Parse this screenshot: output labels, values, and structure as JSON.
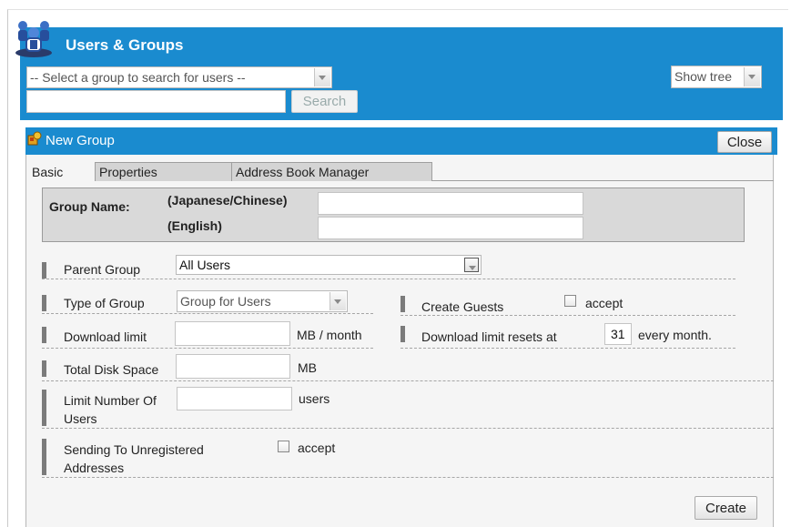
{
  "header": {
    "title": "Users & Groups",
    "group_select": "-- Select a group to search for users --",
    "search_value": "",
    "search_button": "Search",
    "show_tree": "Show tree"
  },
  "panel": {
    "title": "New Group",
    "close_button": "Close",
    "tabs": [
      "Basic",
      "Properties",
      "Address Book Manager"
    ],
    "active_tab": "Basic"
  },
  "form": {
    "group_name_label": "Group Name:",
    "japanese_chinese_label": "(Japanese/Chinese)",
    "english_label": "(English)",
    "parent_group_label": "Parent Group",
    "parent_group_value": "All Users",
    "type_of_group_label": "Type of Group",
    "type_of_group_value": "Group for Users",
    "create_guests_label": "Create Guests",
    "create_guests_accept": "accept",
    "download_limit_label": "Download limit",
    "download_limit_unit": "MB / month",
    "download_reset_label": "Download limit resets at",
    "download_reset_value": "31",
    "download_reset_suffix": "every month.",
    "total_disk_label": "Total Disk Space",
    "total_disk_unit": "MB",
    "limit_users_label_1": "Limit Number Of",
    "limit_users_label_2": "Users",
    "limit_users_unit": "users",
    "sending_label_1": "Sending To Unregistered",
    "sending_label_2": "Addresses",
    "sending_accept": "accept",
    "create_button": "Create"
  },
  "colors": {
    "header_blue": "#1a8bcf",
    "panel_bg": "#f5f5f5",
    "group_box": "#d9d9d9"
  },
  "icons": {
    "logo": "users-groups-logo-icon",
    "panel": "new-group-icon"
  }
}
